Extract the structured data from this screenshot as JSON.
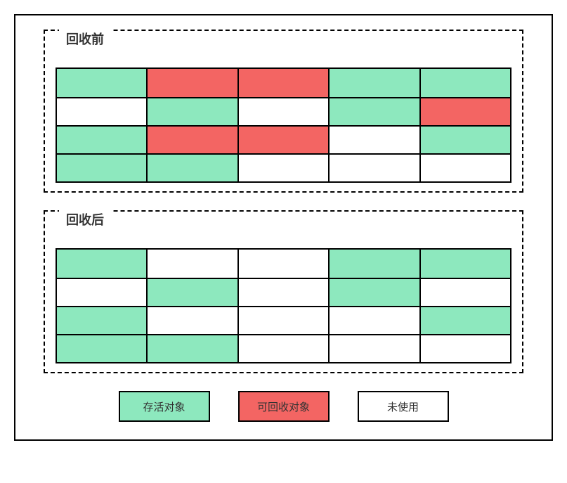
{
  "colors": {
    "alive": "#8de8be",
    "reclaim": "#f36563",
    "unused": "#ffffff"
  },
  "sections": {
    "before": {
      "title": "回收前",
      "grid": [
        [
          "alive",
          "reclaim",
          "reclaim",
          "alive",
          "alive"
        ],
        [
          "unused",
          "alive",
          "unused",
          "alive",
          "reclaim"
        ],
        [
          "alive",
          "reclaim",
          "reclaim",
          "unused",
          "alive"
        ],
        [
          "alive",
          "alive",
          "unused",
          "unused",
          "unused"
        ]
      ]
    },
    "after": {
      "title": "回收后",
      "grid": [
        [
          "alive",
          "unused",
          "unused",
          "alive",
          "alive"
        ],
        [
          "unused",
          "alive",
          "unused",
          "alive",
          "unused"
        ],
        [
          "alive",
          "unused",
          "unused",
          "unused",
          "alive"
        ],
        [
          "alive",
          "alive",
          "unused",
          "unused",
          "unused"
        ]
      ]
    }
  },
  "legend": {
    "alive": "存活对象",
    "reclaim": "可回收对象",
    "unused": "未使用"
  }
}
